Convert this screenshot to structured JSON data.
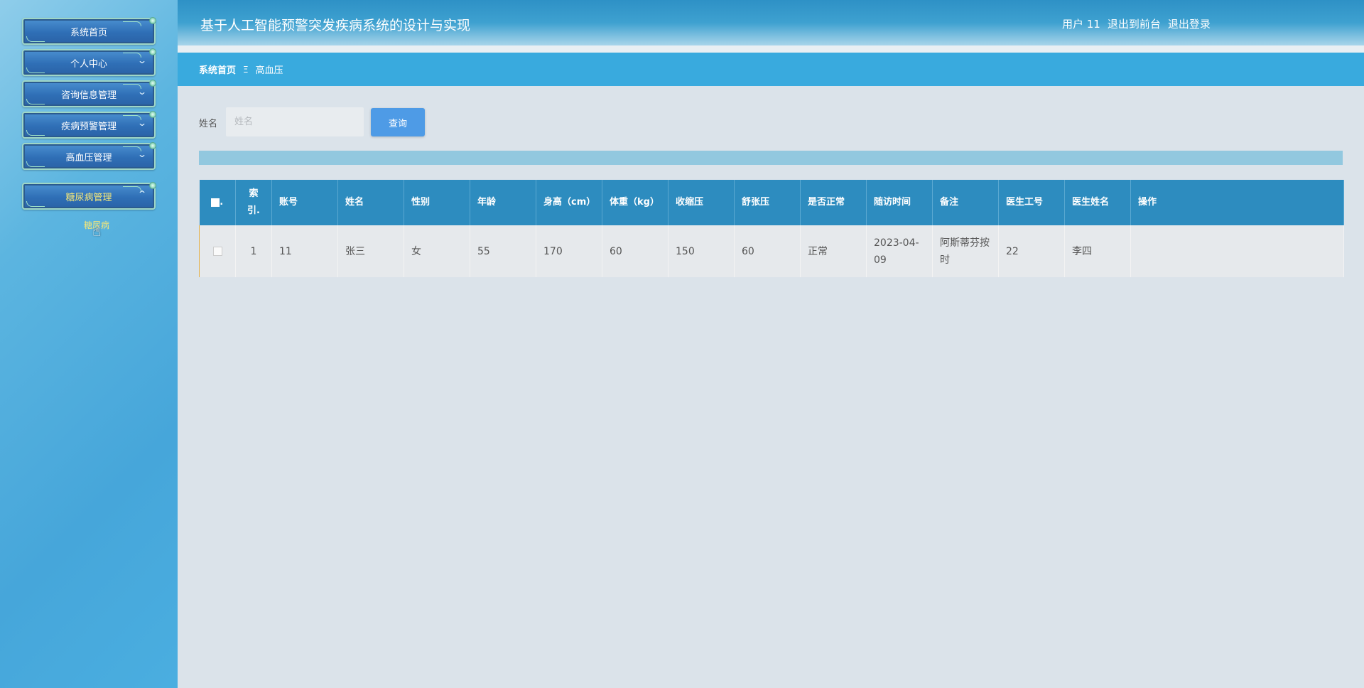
{
  "header": {
    "title": "基于人工智能预警突发疾病系统的设计与实现",
    "user_label": "用户 11",
    "back_front_label": "退出到前台",
    "logout_label": "退出登录"
  },
  "sidebar": {
    "items": [
      {
        "label": "系统首页"
      },
      {
        "label": "个人中心"
      },
      {
        "label": "咨询信息管理"
      },
      {
        "label": "疾病预警管理"
      },
      {
        "label": "高血压管理"
      },
      {
        "label": "糖尿病管理"
      }
    ],
    "submenu": {
      "label": "糖尿病"
    }
  },
  "breadcrumb": {
    "home": "系统首页",
    "separator": "Ξ",
    "current": "高血压"
  },
  "search": {
    "label": "姓名",
    "placeholder": "姓名",
    "value": "",
    "button_label": "查询"
  },
  "table": {
    "headers": [
      "■.",
      "索引.",
      "账号",
      "姓名",
      "性别",
      "年龄",
      "身高（cm）",
      "体重（kg）",
      "收缩压",
      "舒张压",
      "是否正常",
      "随访时间",
      "备注",
      "医生工号",
      "医生姓名",
      "操作"
    ],
    "rows": [
      [
        "",
        "1",
        "11",
        "张三",
        "女",
        "55",
        "170",
        "60",
        "150",
        "60",
        "正常",
        "2023-04-09",
        "阿斯蒂芬按时",
        "22",
        "李四",
        ""
      ]
    ]
  },
  "colors": {
    "header_bg": "#2e91c6",
    "breadcrumb_bg": "#39aade",
    "table_header_bg": "#2d8cbf",
    "button_bg": "#4e9be6",
    "active_menu_text": "#f3e67a"
  }
}
